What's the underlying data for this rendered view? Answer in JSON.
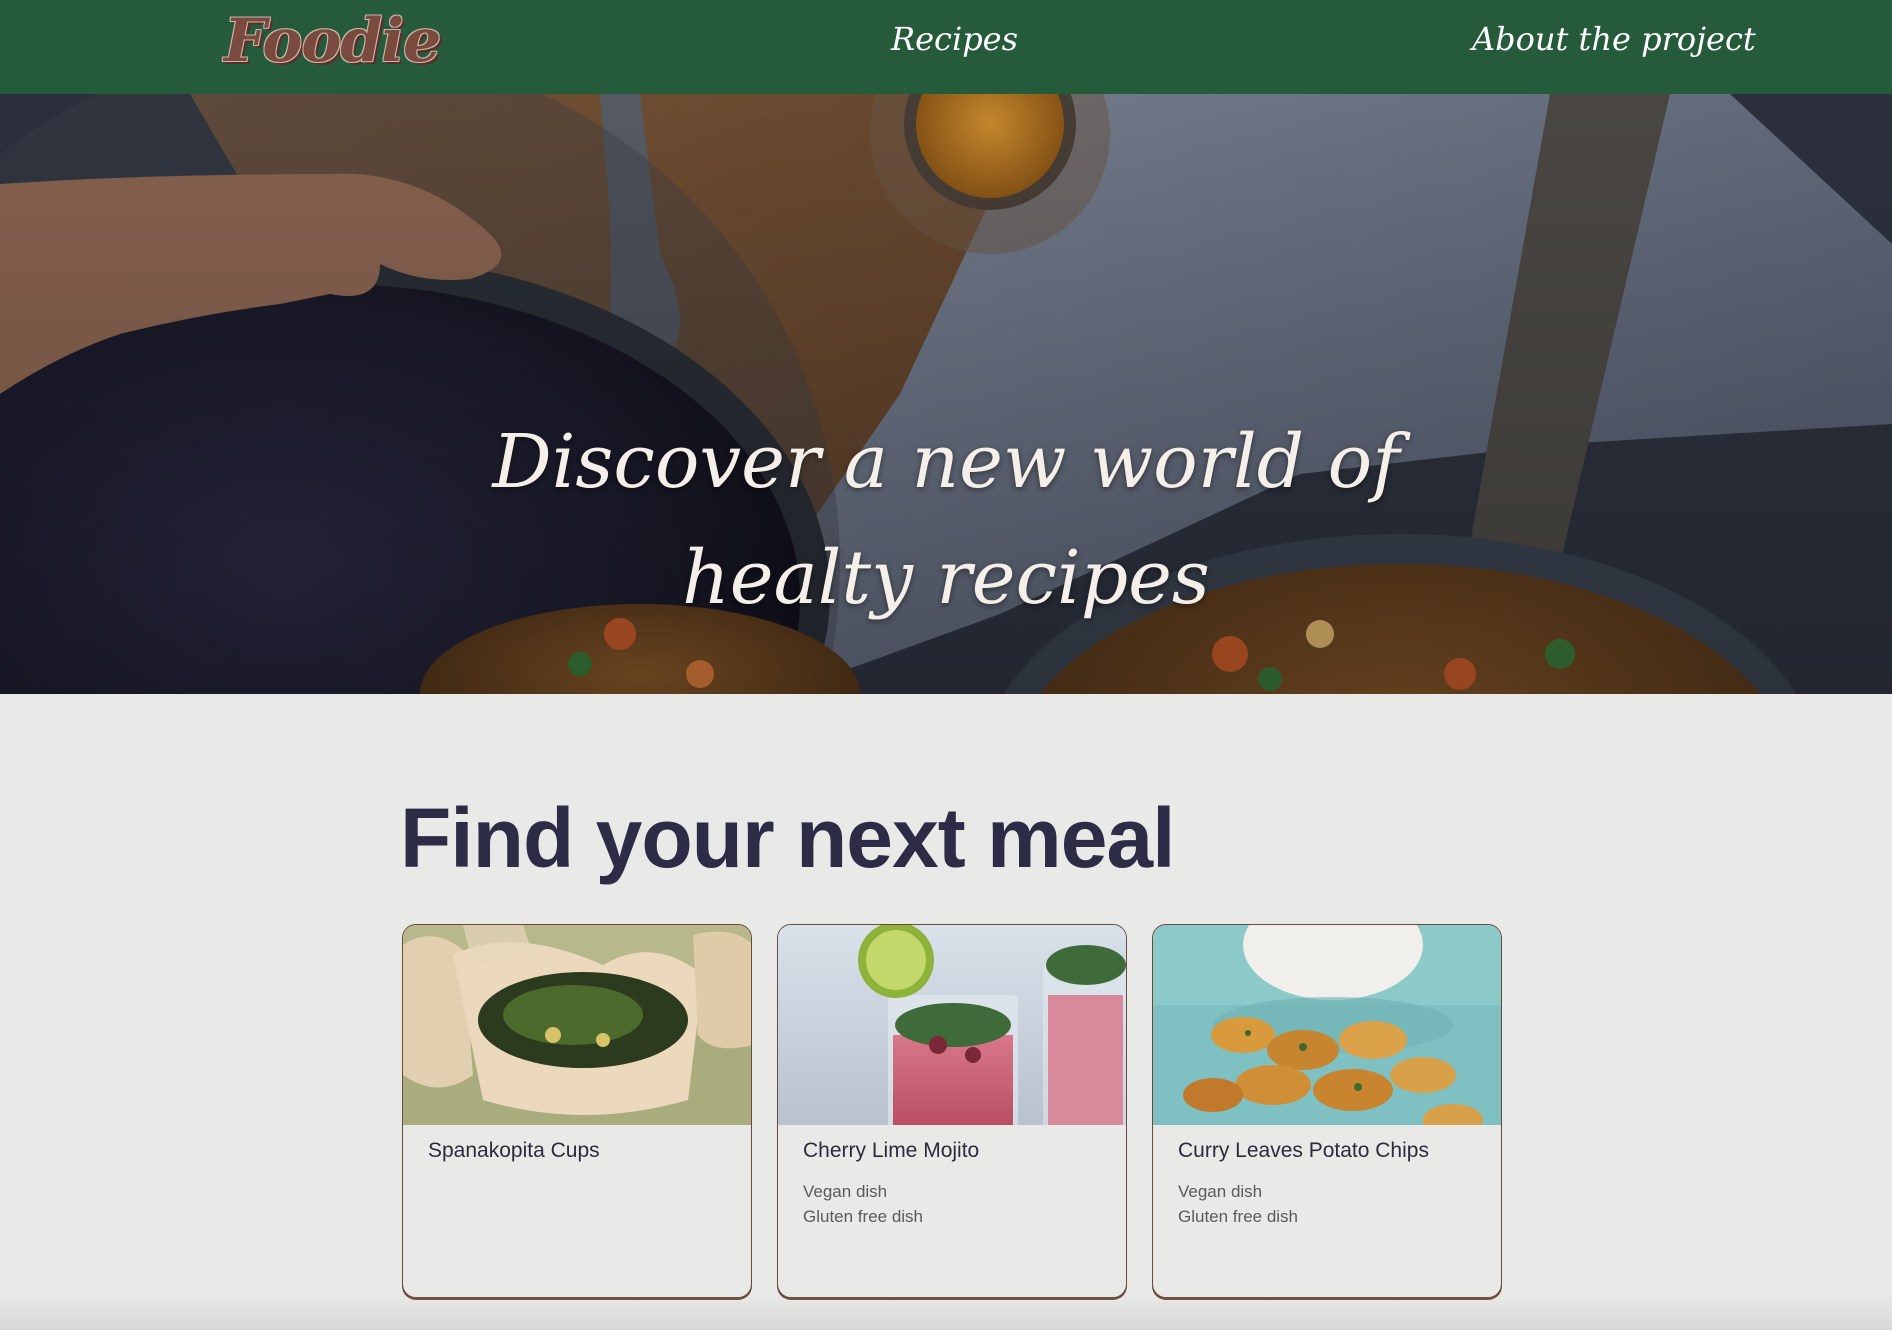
{
  "nav": {
    "logo": "Foodie",
    "links": [
      {
        "label": "Recipes"
      },
      {
        "label": "About the project"
      }
    ]
  },
  "hero": {
    "title_line1": "Discover a new world of",
    "title_line2": "healty recipes"
  },
  "main": {
    "heading": "Find your next meal",
    "recipes": [
      {
        "title": "Spanakopita Cups",
        "tags": []
      },
      {
        "title": "Cherry Lime Mojito",
        "tags": [
          "Vegan dish",
          "Gluten free dish"
        ]
      },
      {
        "title": "Curry Leaves Potato Chips",
        "tags": [
          "Vegan dish",
          "Gluten free dish"
        ]
      }
    ]
  },
  "colors": {
    "nav_bg": "#255a3b",
    "logo": "#7a4a3f",
    "heading": "#2d2b45",
    "card_border": "#6a4a3a",
    "page_bg": "#e9eae8"
  }
}
